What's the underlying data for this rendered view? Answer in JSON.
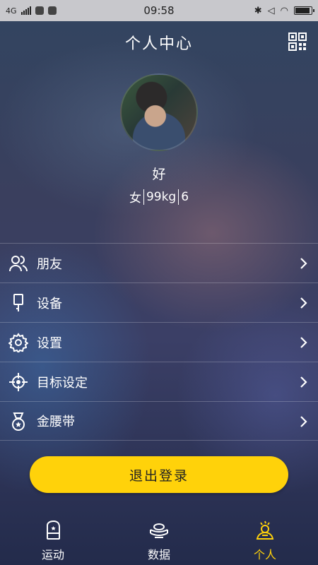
{
  "status_bar": {
    "network": "4G",
    "time": "09:58"
  },
  "header": {
    "title": "个人中心",
    "qr_icon": "qr-code-icon"
  },
  "profile": {
    "nickname": "好",
    "gender": "女",
    "weight": "99kg",
    "extra": "6"
  },
  "menu": [
    {
      "label": "朋友",
      "icon": "friends-icon"
    },
    {
      "label": "设备",
      "icon": "device-icon"
    },
    {
      "label": "设置",
      "icon": "gear-icon"
    },
    {
      "label": "目标设定",
      "icon": "target-icon"
    },
    {
      "label": "金腰带",
      "icon": "medal-icon"
    }
  ],
  "logout_button": "退出登录",
  "tabs": [
    {
      "label": "运动",
      "icon": "boxing-glove-icon",
      "active": false
    },
    {
      "label": "数据",
      "icon": "data-belt-icon",
      "active": false
    },
    {
      "label": "个人",
      "icon": "person-icon",
      "active": true
    }
  ],
  "colors": {
    "accent": "#ffd20a",
    "status_bar": "#c8c8cc"
  }
}
